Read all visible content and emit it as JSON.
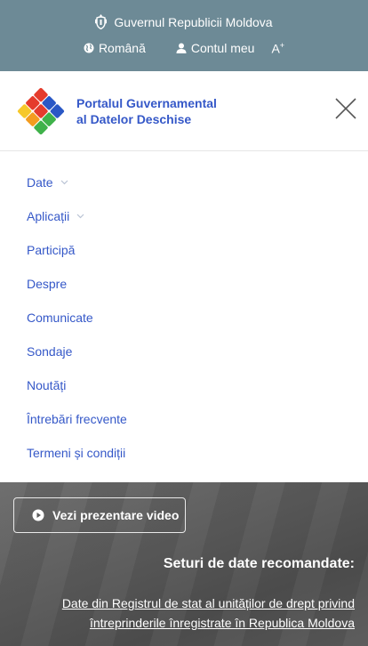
{
  "topbar": {
    "government_label": "Guvernul Republicii Moldova",
    "language_label": "Română",
    "account_label": "Contul meu",
    "font_size_label": "A",
    "font_size_sup": "+"
  },
  "header": {
    "site_title_line1": "Portalul Guvernamental",
    "site_title_line2": "al Datelor Deschise"
  },
  "nav": {
    "items": [
      {
        "label": "Date",
        "has_dropdown": true
      },
      {
        "label": "Aplicații",
        "has_dropdown": true
      },
      {
        "label": "Participă",
        "has_dropdown": false
      },
      {
        "label": "Despre",
        "has_dropdown": false
      },
      {
        "label": "Comunicate",
        "has_dropdown": false
      },
      {
        "label": "Sondaje",
        "has_dropdown": false
      },
      {
        "label": "Noutăți",
        "has_dropdown": false
      },
      {
        "label": "Întrebări frecvente",
        "has_dropdown": false
      },
      {
        "label": "Termeni și condiții",
        "has_dropdown": false
      }
    ]
  },
  "hero": {
    "video_button_label": "Vezi prezentare video",
    "featured_title": "Seturi de date recomandate:",
    "featured_link_line1": "Date din Registrul de stat al unităților de drept privind",
    "featured_link_line2": "întreprinderile înregistrate în Republica Moldova"
  },
  "colors": {
    "topbar_bg": "#6d8a96",
    "link_blue": "#3558c8",
    "hero_bg": "#5a5a5a"
  }
}
